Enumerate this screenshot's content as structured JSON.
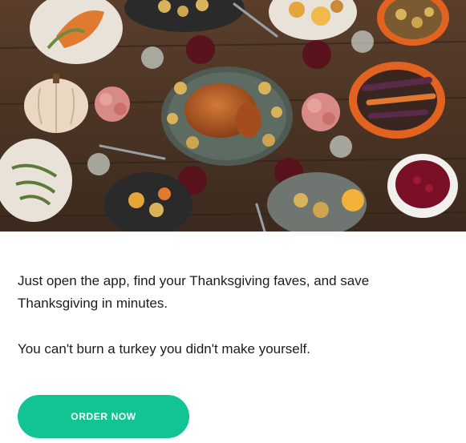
{
  "email": {
    "hero_image": {
      "alt": "Thanksgiving feast with roast turkey and side dishes",
      "colors": {
        "table_wood": "#4a3324",
        "turkey": "#b05a22",
        "plates": "#e8e2d8",
        "cranberry": "#7a0f25",
        "orange_bowl": "#e2621f",
        "greens": "#5d7a3a"
      }
    },
    "body": {
      "paragraph_1": "Just open the app, find your Thanksgiving faves, and save Thanksgiving in minutes.",
      "paragraph_2": "You can't burn a turkey you didn't make yourself."
    },
    "cta": {
      "label": "ORDER NOW",
      "color": "#12c393"
    }
  }
}
